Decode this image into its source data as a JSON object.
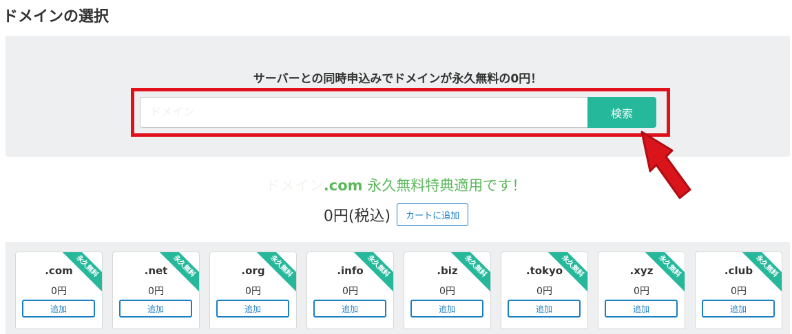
{
  "page": {
    "title": "ドメインの選択"
  },
  "search": {
    "promo": "サーバーとの同時申込みでドメインが永久無料の0円！",
    "placeholder": "ドメイン",
    "button_label": "検索"
  },
  "result": {
    "domain": "ドメイン",
    "ext": ".com",
    "message": " 永久無料特典適用です！",
    "price": "0円(税込)",
    "cart_button": "カートに追加"
  },
  "tlds": [
    {
      "name": ".com",
      "price": "0円",
      "ribbon": "永久無料",
      "add_label": "追加"
    },
    {
      "name": ".net",
      "price": "0円",
      "ribbon": "永久無料",
      "add_label": "追加"
    },
    {
      "name": ".org",
      "price": "0円",
      "ribbon": "永久無料",
      "add_label": "追加"
    },
    {
      "name": ".info",
      "price": "0円",
      "ribbon": "永久無料",
      "add_label": "追加"
    },
    {
      "name": ".biz",
      "price": "0円",
      "ribbon": "永久無料",
      "add_label": "追加"
    },
    {
      "name": ".tokyo",
      "price": "0円",
      "ribbon": "永久無料",
      "add_label": "追加"
    },
    {
      "name": ".xyz",
      "price": "0円",
      "ribbon": "永久無料",
      "add_label": "追加"
    },
    {
      "name": ".club",
      "price": "0円",
      "ribbon": "永久無料",
      "add_label": "追加"
    }
  ],
  "colors": {
    "accent_green": "#26b89b",
    "success_text": "#5cb85c",
    "link_blue": "#1b7fc4",
    "highlight_red": "#e0111a",
    "panel_gray": "#eeeff0"
  },
  "icons": {
    "annotation": "red-arrow-icon"
  }
}
